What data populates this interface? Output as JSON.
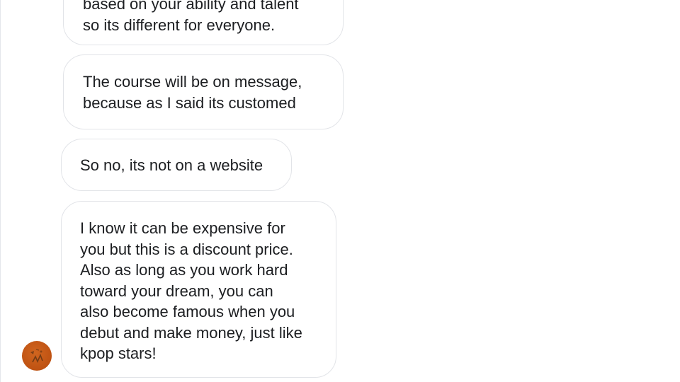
{
  "conversation": {
    "messages": [
      {
        "id": "msg1",
        "lines": [
          "based on your ability and talent",
          "so its different for everyone."
        ]
      },
      {
        "id": "msg2",
        "lines": [
          "The course will be on message,",
          "because as I said its customed"
        ]
      },
      {
        "id": "msg3",
        "lines": [
          "So no, its not on a website"
        ]
      },
      {
        "id": "msg4",
        "lines": [
          "I know it can be expensive for",
          "you but this is a discount price.",
          "Also as long as you work hard",
          "toward your dream, you can",
          "also become famous when you",
          "debut and make money, just like",
          "kpop stars!"
        ]
      }
    ],
    "sender_avatar": {
      "icon": "profile-photo-icon",
      "color": "#c4561a"
    }
  }
}
